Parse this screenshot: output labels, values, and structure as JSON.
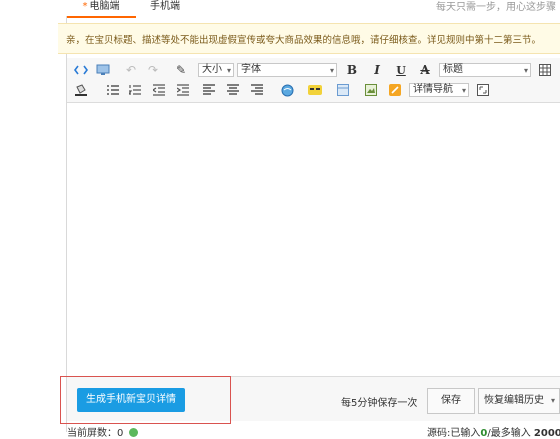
{
  "tabs": {
    "pc_label": "电脑端",
    "mobile_label": "手机端",
    "note": "每天只需一步，用心这步骤"
  },
  "notice": {
    "text": "亲，在宝贝标题、描述等处不能出现虚假宣传或夸大商品效果的信息哦，请仔细核查。详见规则中第十二第三节。"
  },
  "toolbar": {
    "size_label": "大小",
    "font_label": "字体",
    "bold": "B",
    "italic": "I",
    "underline": "U",
    "strike": "A",
    "heading_label": "标题",
    "detail_nav_label": "详情导航"
  },
  "bottom": {
    "generate_button": "生成手机新宝贝详情",
    "autosave_text": "每5分钟保存一次",
    "save_button": "保存",
    "history_button": "恢复编辑历史"
  },
  "status": {
    "screens_label": "当前屏数：",
    "screens_value": "0",
    "source_prefix": "源码:已输入",
    "source_entered": "0",
    "source_sep": "/最多输入",
    "source_max": "2000"
  },
  "colors": {
    "accent": "#1a9ce3",
    "tab_active": "#ff6600",
    "highlight_border": "#d9534f"
  }
}
